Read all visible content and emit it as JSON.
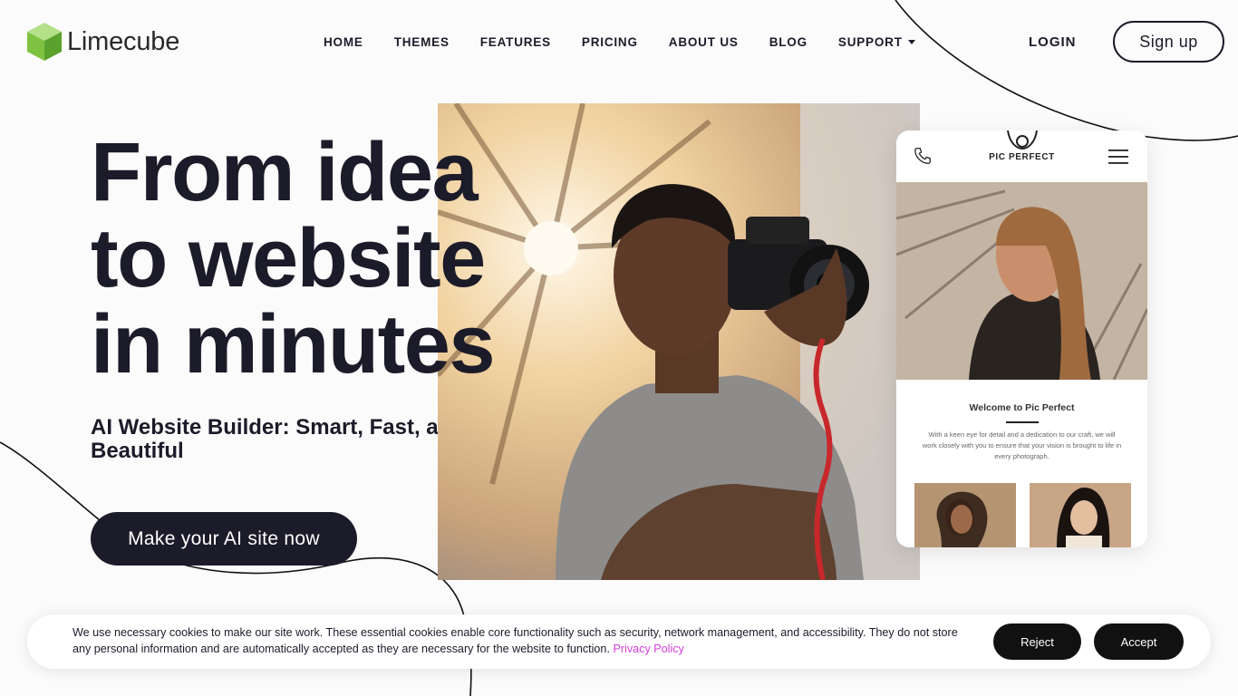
{
  "brand": {
    "name": "Limecube",
    "accent": "#8cc63f"
  },
  "nav": {
    "items": [
      {
        "label": "HOME"
      },
      {
        "label": "THEMES"
      },
      {
        "label": "FEATURES"
      },
      {
        "label": "PRICING"
      },
      {
        "label": "ABOUT US"
      },
      {
        "label": "BLOG"
      },
      {
        "label": "SUPPORT",
        "icon": "caret-down-icon"
      }
    ],
    "login": "LOGIN",
    "signup": "Sign up"
  },
  "hero": {
    "title_lines": [
      "From idea",
      "to website",
      "in minutes"
    ],
    "subtitle": "AI Website Builder: Smart, Fast, and Beautiful",
    "cta": "Make your AI site now"
  },
  "mockup": {
    "brand": "PIC PERFECT",
    "welcome": "Welcome to Pic Perfect",
    "description": "With a keen eye for detail and a dedication to our craft, we will work closely with you to ensure that your vision is brought to life in every photograph."
  },
  "cookie": {
    "text": "We use necessary cookies to make our site work. These essential cookies enable core functionality such as security, network management, and accessibility. They do not store any personal information and are automatically accepted as they are necessary for the website to function.",
    "link": "Privacy Policy",
    "link_color": "#d23fd9",
    "reject": "Reject",
    "accept": "Accept"
  },
  "colors": {
    "text": "#1c1b29",
    "background": "#fbfbfb"
  }
}
